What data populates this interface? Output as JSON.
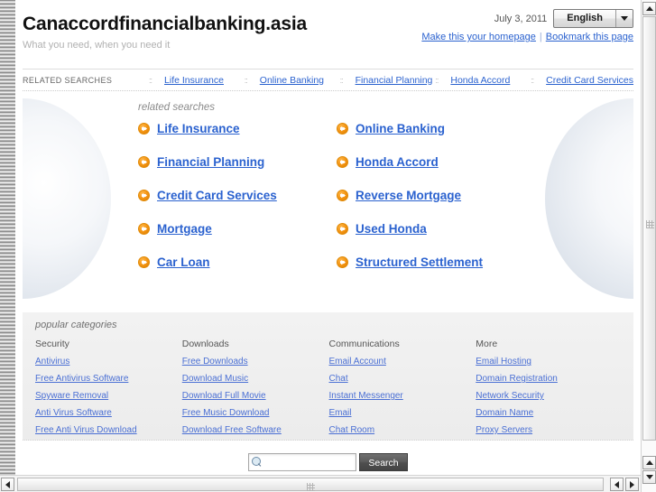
{
  "header": {
    "site_title": "Canaccordfinancialbanking.asia",
    "tagline": "What you need, when you need it",
    "date": "July 3, 2011",
    "language": "English",
    "make_homepage": "Make this your homepage",
    "bookmark": "Bookmark this page"
  },
  "related_strip": {
    "label": "RELATED SEARCHES",
    "items": [
      "Life Insurance",
      "Online Banking",
      "Financial Planning",
      "Honda Accord",
      "Credit Card Services"
    ]
  },
  "main": {
    "heading": "related searches",
    "links": [
      "Life Insurance",
      "Online Banking",
      "Financial Planning",
      "Honda Accord",
      "Credit Card Services",
      "Reverse Mortgage",
      "Mortgage",
      "Used Honda",
      "Car Loan",
      "Structured Settlement"
    ]
  },
  "categories": {
    "heading": "popular categories",
    "columns": [
      {
        "title": "Security",
        "links": [
          "Antivirus",
          "Free Antivirus Software",
          "Spyware Removal",
          "Anti Virus Software",
          "Free Anti Virus Download"
        ]
      },
      {
        "title": "Downloads",
        "links": [
          "Free Downloads",
          "Download Music",
          "Download Full Movie",
          "Free Music Download",
          "Download Free Software"
        ]
      },
      {
        "title": "Communications",
        "links": [
          "Email Account",
          "Chat",
          "Instant Messenger",
          "Email",
          "Chat Room"
        ]
      },
      {
        "title": "More",
        "links": [
          "Email Hosting",
          "Domain Registration",
          "Network Security",
          "Domain Name",
          "Proxy Servers"
        ]
      }
    ]
  },
  "search": {
    "value": "",
    "placeholder": "",
    "button_label": "Search"
  },
  "icons": {
    "arrow_circle": "➜",
    "magnifier": "search-icon",
    "chevron_down": "chevron-down-icon"
  },
  "colors": {
    "link": "#2b62cf",
    "accent_orange": "#f2920f",
    "panel_bg": "#efefef"
  }
}
